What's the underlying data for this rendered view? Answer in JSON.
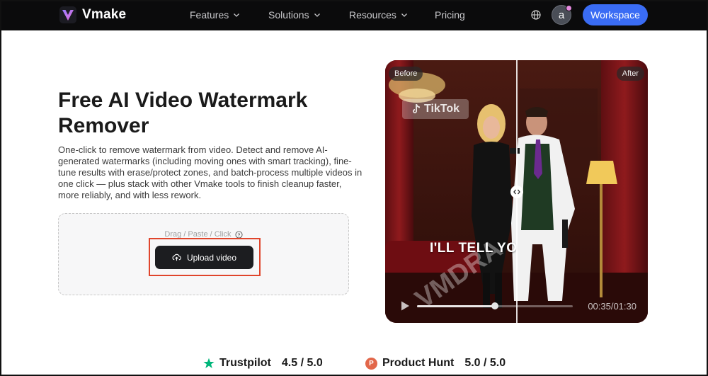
{
  "nav": {
    "brand": "Vmake",
    "items": [
      {
        "label": "Features",
        "has_dropdown": true
      },
      {
        "label": "Solutions",
        "has_dropdown": true
      },
      {
        "label": "Resources",
        "has_dropdown": true
      },
      {
        "label": "Pricing",
        "has_dropdown": false
      }
    ],
    "avatar_letter": "a",
    "workspace_label": "Workspace",
    "globe_icon": "globe-icon"
  },
  "hero": {
    "title": "Free AI Video Watermark Remover",
    "description": "One-click to remove watermark from video. Detect and remove AI-generated watermarks (including moving ones with smart tracking), fine-tune results with erase/protect zones, and batch-process multiple videos in one click — plus stack with other Vmake tools to finish cleanup faster, more reliably, and with less rework.",
    "dropzone_hint": "Drag / Paste / Click",
    "upload_label": "Upload video"
  },
  "preview": {
    "before_label": "Before",
    "after_label": "After",
    "watermark_text": "TikTok",
    "caption": "I'LL TELL YOU",
    "time": "00:35/01:30",
    "progress": 0.5
  },
  "ratings": [
    {
      "source": "Trustpilot",
      "score": "4.5 / 5.0"
    },
    {
      "source": "Product Hunt",
      "score": "5.0 / 5.0"
    }
  ],
  "colors": {
    "accent": "#3a6cf4",
    "nav_bg": "#0b0b0c",
    "highlight": "#e0452c",
    "trustpilot": "#00b67a",
    "producthunt": "#e2674a"
  }
}
